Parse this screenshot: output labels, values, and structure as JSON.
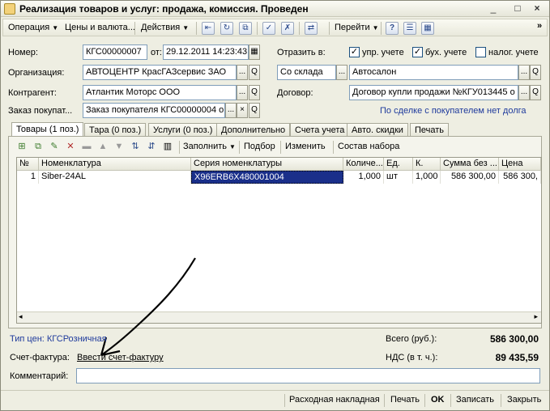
{
  "window": {
    "title": "Реализация товаров и услуг: продажа, комиссия. Проведен",
    "min_symbol": "_",
    "max_symbol": "□",
    "close_symbol": "×"
  },
  "toolbar": {
    "operation": "Операция",
    "prices_currency": "Цены и валюта...",
    "actions": "Действия",
    "go_to": "Перейти",
    "help_symbol": "?",
    "overflow_symbol": "»"
  },
  "form": {
    "number_label": "Номер:",
    "number_value": "КГС00000007",
    "from_label": "от:",
    "date_value": "29.12.2011 14:23:43",
    "org_label": "Организация:",
    "org_value": "АВТОЦЕНТР КрасГАЗсервис ЗАО",
    "counterparty_label": "Контрагент:",
    "counterparty_value": "Атлантик Моторс ООО",
    "order_label": "Заказ покупат...",
    "order_value": "Заказ покупателя КГС00000004 о",
    "reflect_label": "Отразить в:",
    "chk_mgmt": "упр. учете",
    "chk_acc": "бух. учете",
    "chk_tax": "налог. учете",
    "warehouse_type": "Со склада",
    "warehouse_value": "Автосалон",
    "contract_label": "Договор:",
    "contract_value": "Договор купли продажи №КГУ013445 о",
    "debt_status": "По сделке с покупателем нет долга",
    "button_ellipsis": "...",
    "button_search": "Q",
    "button_clear": "×"
  },
  "tabs": [
    {
      "label": "Товары (1 поз.)"
    },
    {
      "label": "Тара (0 поз.)"
    },
    {
      "label": "Услуги (0 поз.)"
    },
    {
      "label": "Дополнительно"
    },
    {
      "label": "Счета учета"
    },
    {
      "label": "Авто. скидки"
    },
    {
      "label": "Печать"
    }
  ],
  "panel_toolbar": {
    "fill": "Заполнить",
    "pick": "Подбор",
    "change": "Изменить",
    "set_composition": "Состав набора"
  },
  "table": {
    "headers": [
      "№",
      "Номенклатура",
      "Серия номенклатуры",
      "Количе...",
      "Ед.",
      "К.",
      "Сумма без ...",
      "Цена"
    ],
    "rows": [
      [
        "1",
        "Siber-24AL",
        "X96ERB6X480001004",
        "1,000",
        "шт",
        "1,000",
        "586 300,00",
        "586 300,"
      ]
    ]
  },
  "footer": {
    "price_type": "Тип цен: КГСРозничная",
    "total_label": "Всего (руб.):",
    "total_value": "586 300,00",
    "invoice_label": "Счет-фактура:",
    "invoice_link": "Ввести счет-фактуру",
    "vat_label": "НДС (в т. ч.):",
    "vat_value": "89 435,59",
    "comment_label": "Комментарий:",
    "comment_value": ""
  },
  "bottom_buttons": {
    "invoice": "Расходная накладная",
    "print": "Печать",
    "ok": "OK",
    "save": "Записать",
    "close": "Закрыть"
  },
  "colors": {
    "accent_selected_cell": "#1a2f8a",
    "link": "#1e3a9c"
  }
}
